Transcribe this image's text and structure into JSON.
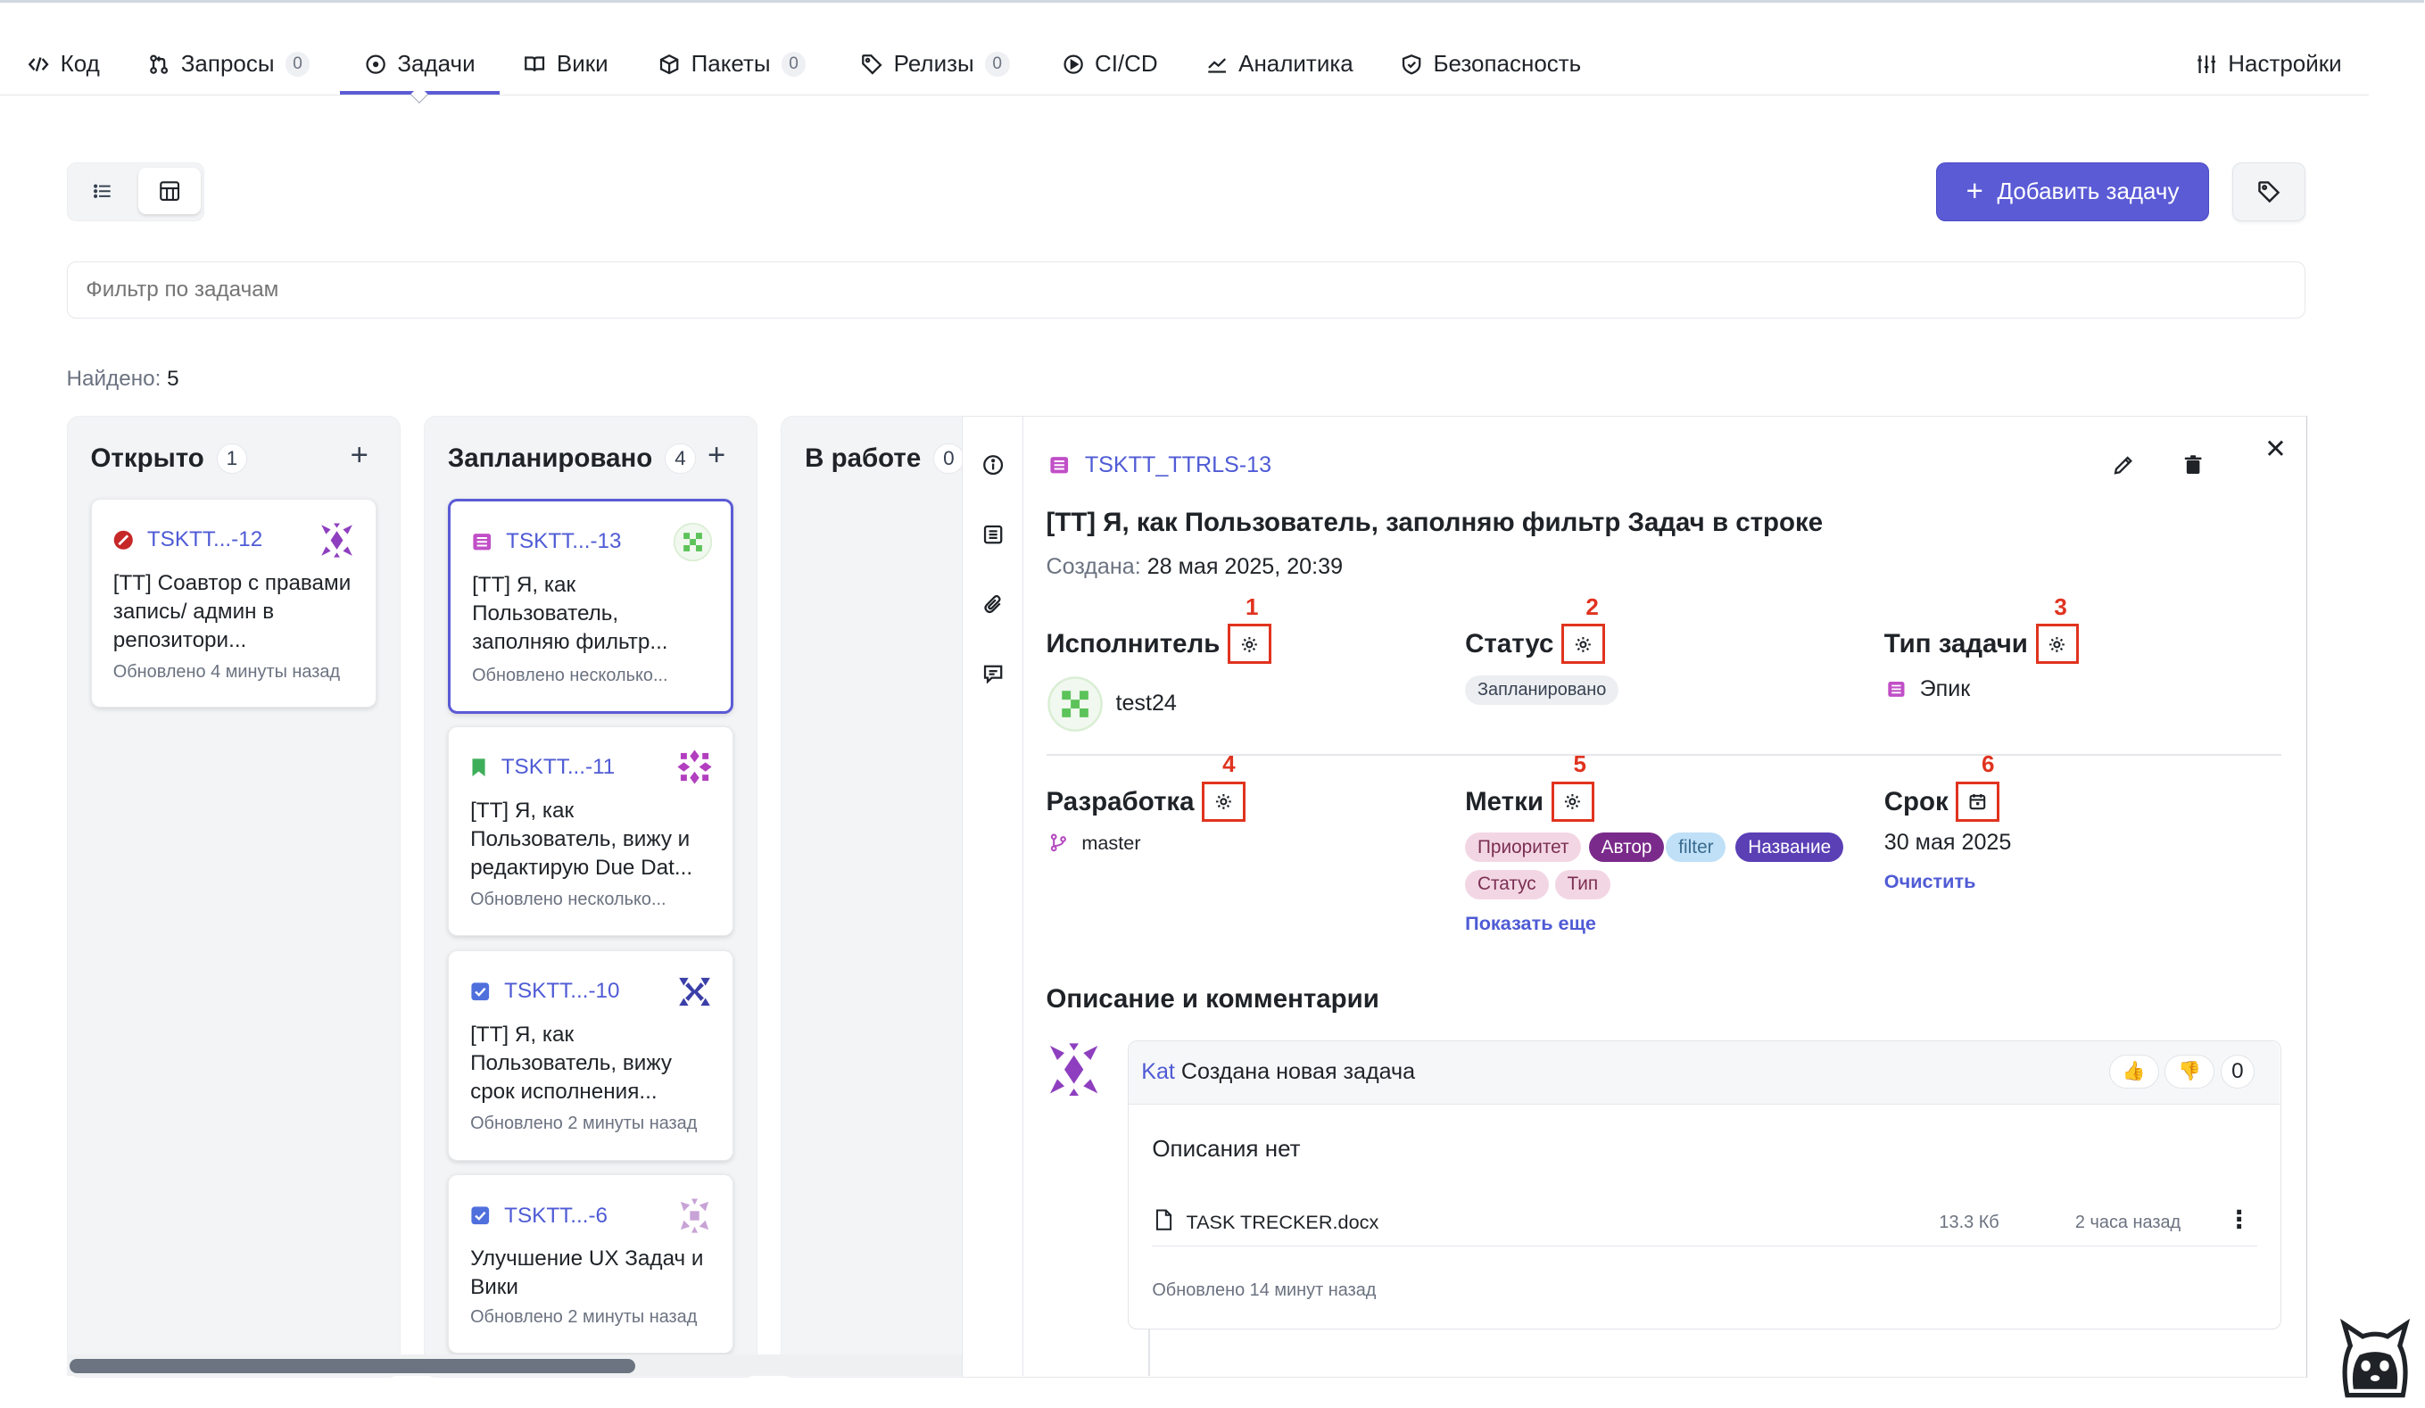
{
  "nav": {
    "items": [
      {
        "label": "Код",
        "icon": "code-icon"
      },
      {
        "label": "Запросы",
        "icon": "merge-request-icon",
        "count": "0"
      },
      {
        "label": "Задачи",
        "icon": "issue-circle-icon"
      },
      {
        "label": "Вики",
        "icon": "book-icon"
      },
      {
        "label": "Пакеты",
        "icon": "package-icon",
        "count": "0"
      },
      {
        "label": "Релизы",
        "icon": "tag-icon",
        "count": "0"
      },
      {
        "label": "CI/CD",
        "icon": "play-circle-icon"
      },
      {
        "label": "Аналитика",
        "icon": "chart-line-icon"
      },
      {
        "label": "Безопасность",
        "icon": "shield-icon"
      }
    ],
    "settings_label": "Настройки",
    "active_index": 2
  },
  "toolbar": {
    "add_task_label": "Добавить задачу",
    "filter_placeholder": "Фильтр по задачам",
    "found_label": "Найдено:",
    "found_count": "5"
  },
  "columns": [
    {
      "title": "Открыто",
      "count": "1",
      "cards": [
        {
          "id": "TSKTT...-12",
          "type_icon": "blocked-circle-icon",
          "title": "[TT] Соавтор с правами запись/ админ в репозитори...",
          "updated": "Обновлено 4 минуты назад"
        }
      ]
    },
    {
      "title": "Запланировано",
      "count": "4",
      "cards": [
        {
          "id": "TSKTT...-13",
          "type_icon": "epic-icon",
          "title": "[TT] Я, как Пользователь, заполняю фильтр...",
          "updated": "Обновлено несколько..."
        },
        {
          "id": "TSKTT...-11",
          "type_icon": "bookmark-icon",
          "title": "[TT] Я, как Пользователь, вижу и редактирую Due Dat...",
          "updated": "Обновлено несколько..."
        },
        {
          "id": "TSKTT...-10",
          "type_icon": "checkbox-icon",
          "title": "[TT] Я, как Пользователь, вижу срок исполнения...",
          "updated": "Обновлено 2 минуты назад"
        },
        {
          "id": "TSKTT...-6",
          "type_icon": "checkbox-icon",
          "title": "Улучшение UX Задач и Вики",
          "updated": "Обновлено 2 минуты назад"
        }
      ]
    },
    {
      "title": "В работе",
      "count": "0",
      "cards": []
    }
  ],
  "detail": {
    "id": "TSKTT_TTRLS-13",
    "title": "[TT] Я, как Пользователь, заполняю фильтр Задач в строке",
    "created_label": "Создана:",
    "created_value": "28 мая 2025, 20:39",
    "assignee": {
      "label": "Исполнитель",
      "marker": "1",
      "value": "test24"
    },
    "status": {
      "label": "Статус",
      "marker": "2",
      "value": "Запланировано"
    },
    "type": {
      "label": "Тип задачи",
      "marker": "3",
      "value": "Эпик"
    },
    "development": {
      "label": "Разработка",
      "marker": "4",
      "branch": "master"
    },
    "labels": {
      "label": "Метки",
      "marker": "5",
      "items": [
        {
          "text": "Приоритет",
          "bg": "#f3d6e4",
          "fg": "#7a2f52"
        },
        {
          "text": "Автор",
          "bg": "#7a2a8a",
          "fg": "#ffffff"
        },
        {
          "text": "filter",
          "bg": "#bfe0f7",
          "fg": "#3b6b8f"
        },
        {
          "text": "Название",
          "bg": "#5a3fb5",
          "fg": "#ffffff"
        },
        {
          "text": "Статус",
          "bg": "#f3d6e4",
          "fg": "#7a2f52"
        },
        {
          "text": "Тип",
          "bg": "#f3d6e4",
          "fg": "#7a2f52"
        }
      ],
      "show_more": "Показать еще"
    },
    "due": {
      "label": "Срок",
      "marker": "6",
      "value": "30 мая 2025",
      "clear_label": "Очистить"
    },
    "description_heading": "Описание и комментарии",
    "comment": {
      "author": "Kat",
      "text": "Создана новая задача",
      "reaction_count": "0",
      "empty_text": "Описания нет",
      "file_name": "TASK TRECKER.docx",
      "file_size": "13.3 Кб",
      "file_time": "2 часа назад",
      "updated": "Обновлено 14 минут назад"
    }
  },
  "colors": {
    "accent": "#5b5bd6",
    "link": "#4f5bd5",
    "annotation_red": "#e0331f"
  }
}
